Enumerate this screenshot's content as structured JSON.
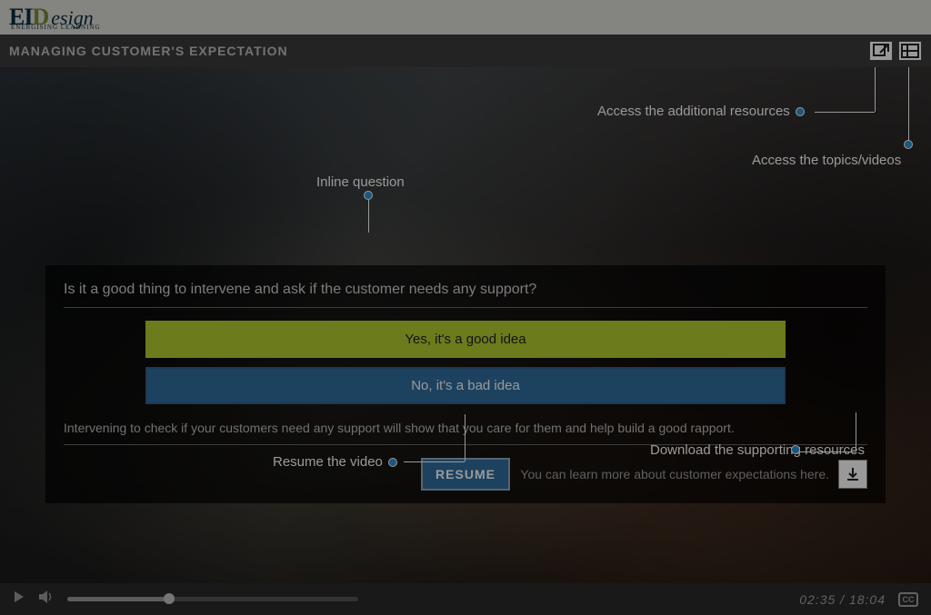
{
  "brand": {
    "part1": "EI",
    "part2": "D",
    "part3": "esign",
    "tagline": "ENERGISING LEARNING"
  },
  "titlebar": {
    "title": "MANAGING CUSTOMER'S EXPECTATION"
  },
  "callouts": {
    "inline_question": "Inline question",
    "resources": "Access the additional resources",
    "topics": "Access the topics/videos",
    "resume": "Resume the video",
    "download": "Download the supporting resources"
  },
  "panel": {
    "question": "Is it a good thing to intervene and ask if the customer needs any support?",
    "options": [
      {
        "label": "Yes, it's a good idea",
        "selected": true
      },
      {
        "label": "No, it's a bad idea",
        "selected": false
      }
    ],
    "feedback": "Intervening to check if your customers need any support will show that you care for them and help build a good rapport.",
    "resume_label": "RESUME",
    "learn_more": "You can learn more about customer expectations here."
  },
  "player": {
    "current_time": "02:35",
    "duration": "18:04"
  }
}
